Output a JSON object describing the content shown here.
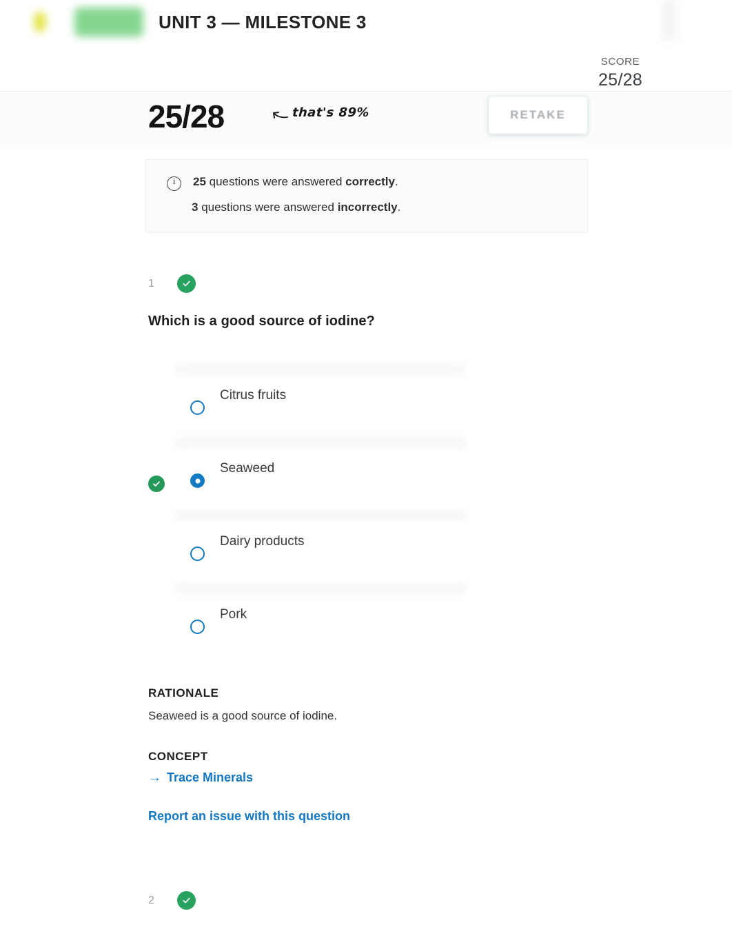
{
  "header": {
    "unit_title": "UNIT 3 — MILESTONE 3",
    "score_label": "SCORE",
    "score_value": "25/28",
    "logo_icon": "sophia-logo-icon"
  },
  "results": {
    "big_score": "25/28",
    "annotation": "that's 89%",
    "annotation_arrow_icon": "curved-arrow-left-icon",
    "retake_label": "RETAKE"
  },
  "summary": {
    "info_icon": "info-circle-icon",
    "correct_count": "25",
    "correct_text_mid": " questions were answered ",
    "correct_word": "correctly",
    "correct_period": ".",
    "incorrect_count": "3",
    "incorrect_text_mid": " questions were answered ",
    "incorrect_word": "incorrectly",
    "incorrect_period": "."
  },
  "question": {
    "number": "1",
    "status_icon": "check-circle-icon",
    "prompt": "Which is a good source of iodine?",
    "options": [
      {
        "label": "Citrus fruits",
        "selected": false,
        "correct": false
      },
      {
        "label": "Seaweed",
        "selected": true,
        "correct": true
      },
      {
        "label": "Dairy products",
        "selected": false,
        "correct": false
      },
      {
        "label": "Pork",
        "selected": false,
        "correct": false
      }
    ],
    "rationale_heading": "RATIONALE",
    "rationale_text": "Seaweed is a good source of iodine.",
    "concept_heading": "CONCEPT",
    "concept_link": "Trace Minerals",
    "concept_link_arrow": "→",
    "report_link": "Report an issue with this question"
  },
  "next_question": {
    "number": "2",
    "status_icon": "check-circle-icon"
  },
  "colors": {
    "correct_green": "#28a35f",
    "radio_blue": "#1379c0",
    "link_blue": "#1478c2",
    "muted_grey": "#9a9a9a"
  }
}
